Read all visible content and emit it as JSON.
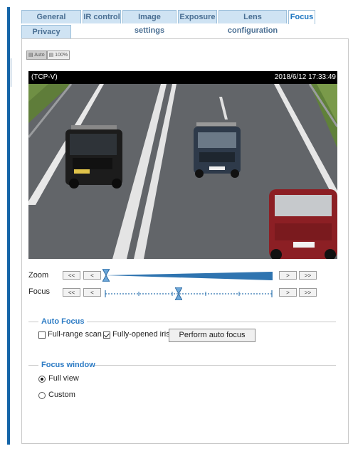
{
  "tabs": [
    {
      "label": "General settings"
    },
    {
      "label": "IR control"
    },
    {
      "label": "Image settings"
    },
    {
      "label": "Exposure"
    },
    {
      "label": "Lens configuration"
    },
    {
      "label": "Focus",
      "active": true
    },
    {
      "label": "Privacy mask"
    }
  ],
  "view_buttons": {
    "auto": "Auto",
    "full": "100%"
  },
  "video": {
    "stream": "(TCP-V)",
    "timestamp": "2018/6/12 17:33:49"
  },
  "zoom": {
    "label": "Zoom",
    "btn_far_left": "<<",
    "btn_left": "<",
    "btn_right": ">",
    "btn_far_right": ">>",
    "level": 0.0
  },
  "focus": {
    "label": "Focus",
    "btn_far_left": "<<",
    "btn_left": "<",
    "btn_right": ">",
    "btn_far_right": ">>",
    "level": 0.44
  },
  "auto_focus": {
    "legend": "Auto Focus",
    "full_range_scan": {
      "label": "Full-range scan",
      "checked": false
    },
    "fully_opened_iris": {
      "label": "Fully-opened iris",
      "checked": true
    },
    "perform_button": "Perform auto focus"
  },
  "focus_window": {
    "legend": "Focus window",
    "options": [
      {
        "label": "Full view",
        "selected": true
      },
      {
        "label": "Custom",
        "selected": false
      }
    ]
  },
  "colors": {
    "accent": "#1565a8",
    "legend": "#2c7bc4",
    "tab_bg": "#cfe3f3",
    "slider": "#2f74b0"
  }
}
